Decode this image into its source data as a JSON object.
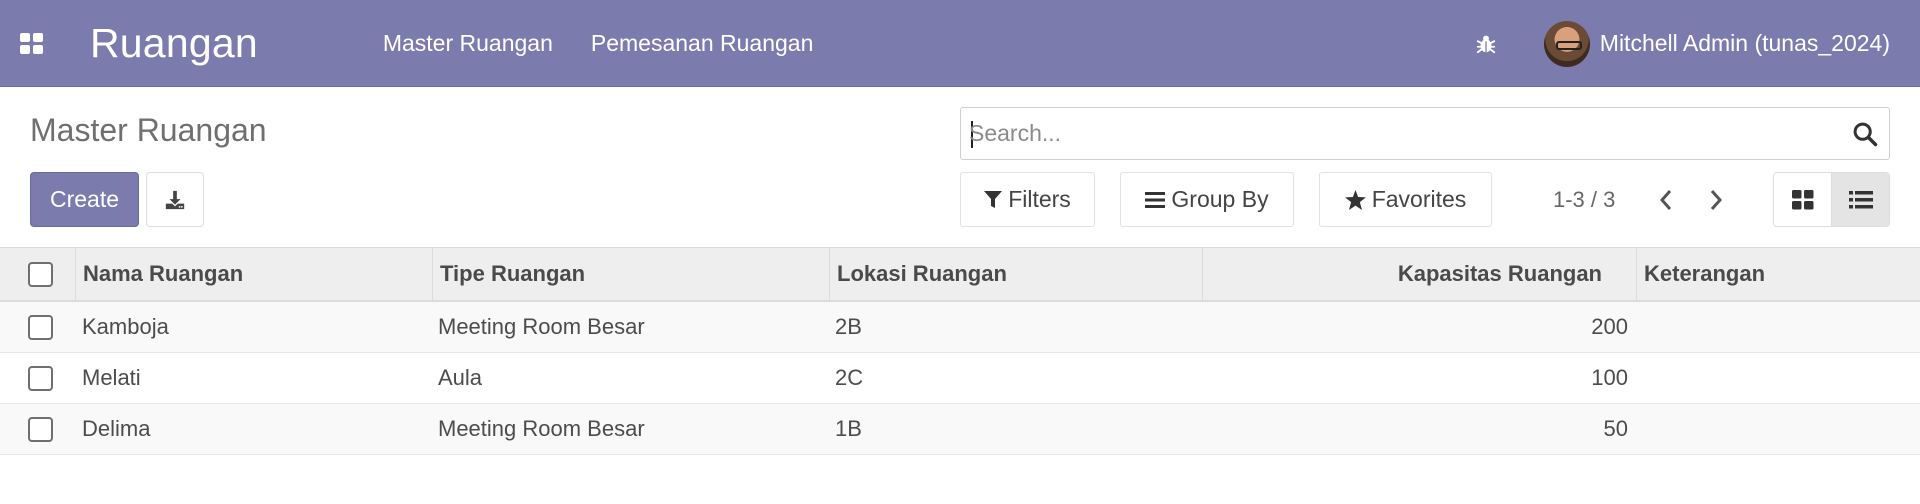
{
  "navbar": {
    "app_title": "Ruangan",
    "menu": [
      {
        "label": "Master Ruangan"
      },
      {
        "label": "Pemesanan Ruangan"
      }
    ],
    "user": "Mitchell Admin (tunas_2024)",
    "colors": {
      "bar": "#7c7bad"
    }
  },
  "control_panel": {
    "title": "Master Ruangan",
    "create_label": "Create",
    "search_placeholder": "Search...",
    "filters_label": "Filters",
    "group_by_label": "Group By",
    "favorites_label": "Favorites",
    "pager": "1-3 / 3",
    "active_view": "list"
  },
  "table": {
    "columns": [
      "Nama Ruangan",
      "Tipe Ruangan",
      "Lokasi Ruangan",
      "Kapasitas Ruangan",
      "Keterangan"
    ],
    "rows": [
      {
        "nama": "Kamboja",
        "tipe": "Meeting Room Besar",
        "lokasi": "2B",
        "kapasitas": "200",
        "keterangan": ""
      },
      {
        "nama": "Melati",
        "tipe": "Aula",
        "lokasi": "2C",
        "kapasitas": "100",
        "keterangan": ""
      },
      {
        "nama": "Delima",
        "tipe": "Meeting Room Besar",
        "lokasi": "1B",
        "kapasitas": "50",
        "keterangan": ""
      }
    ]
  }
}
